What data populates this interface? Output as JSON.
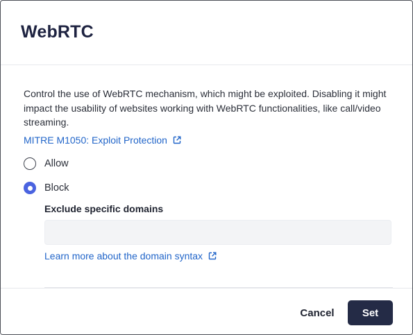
{
  "dialog": {
    "title": "WebRTC",
    "description": "Control the use of WebRTC mechanism, which might be exploited. Disabling it might impact the usability of websites working with WebRTC functionalities, like call/video streaming.",
    "mitre_link": "MITRE M1050: Exploit Protection",
    "options": [
      {
        "label": "Allow",
        "selected": false
      },
      {
        "label": "Block",
        "selected": true
      }
    ],
    "exclude": {
      "label": "Exclude specific domains",
      "value": "",
      "placeholder": ""
    },
    "syntax_link": "Learn more about the domain syntax",
    "buttons": {
      "cancel": "Cancel",
      "set": "Set"
    }
  },
  "colors": {
    "link": "#2165c9",
    "radio_selected": "#4a63e0",
    "primary_button": "#242b46",
    "title": "#1d2240"
  },
  "icons": {
    "external_link": "external-link-icon"
  }
}
